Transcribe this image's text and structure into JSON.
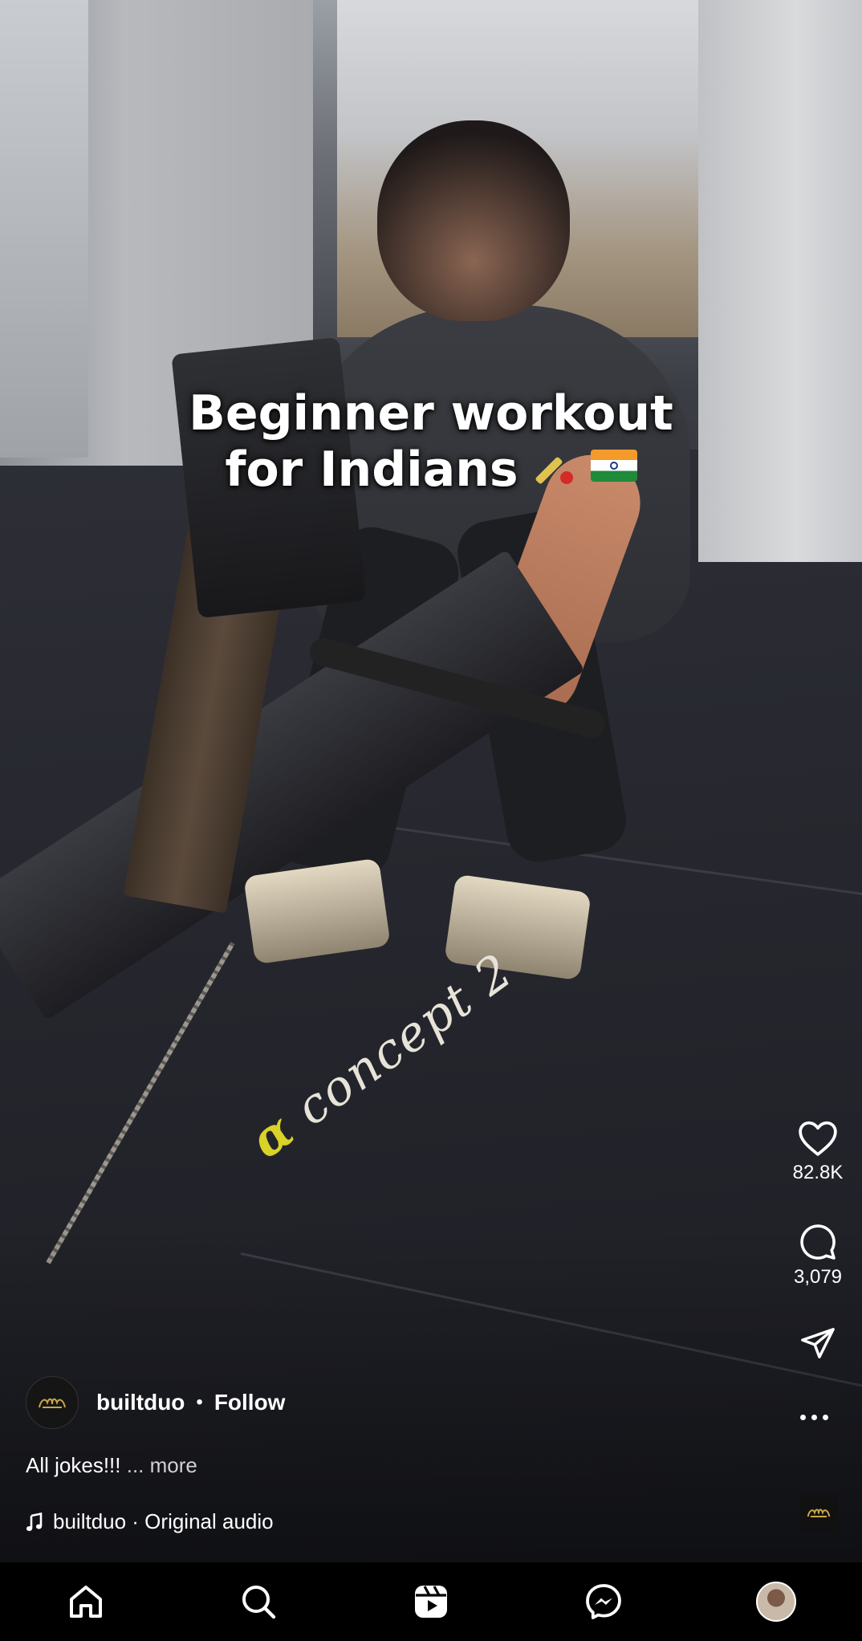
{
  "video": {
    "caption_line1": "Beginner workout",
    "caption_line2": "for Indians",
    "brand_alpha": "α",
    "brand_text": "concept 2"
  },
  "actions": {
    "like": {
      "icon": "heart-icon",
      "count": "82.8K"
    },
    "comment": {
      "icon": "comment-icon",
      "count": "3,079"
    },
    "share": {
      "icon": "send-icon"
    },
    "more": {
      "icon": "more-dots-icon"
    }
  },
  "author": {
    "username": "builtduo",
    "separator": "•",
    "follow_label": "Follow"
  },
  "description": {
    "text": "All jokes!!!",
    "more_label": "... more"
  },
  "audio": {
    "icon": "music-note-icon",
    "label": "builtduo · Original audio"
  },
  "nav": {
    "items": [
      {
        "name": "home",
        "icon": "home-icon"
      },
      {
        "name": "search",
        "icon": "search-icon"
      },
      {
        "name": "reels",
        "icon": "reels-icon"
      },
      {
        "name": "messenger",
        "icon": "messenger-icon"
      },
      {
        "name": "profile",
        "icon": "profile-avatar"
      }
    ]
  },
  "colors": {
    "text": "#ffffff",
    "background": "#000000",
    "brand_yellow": "#d8d229"
  }
}
